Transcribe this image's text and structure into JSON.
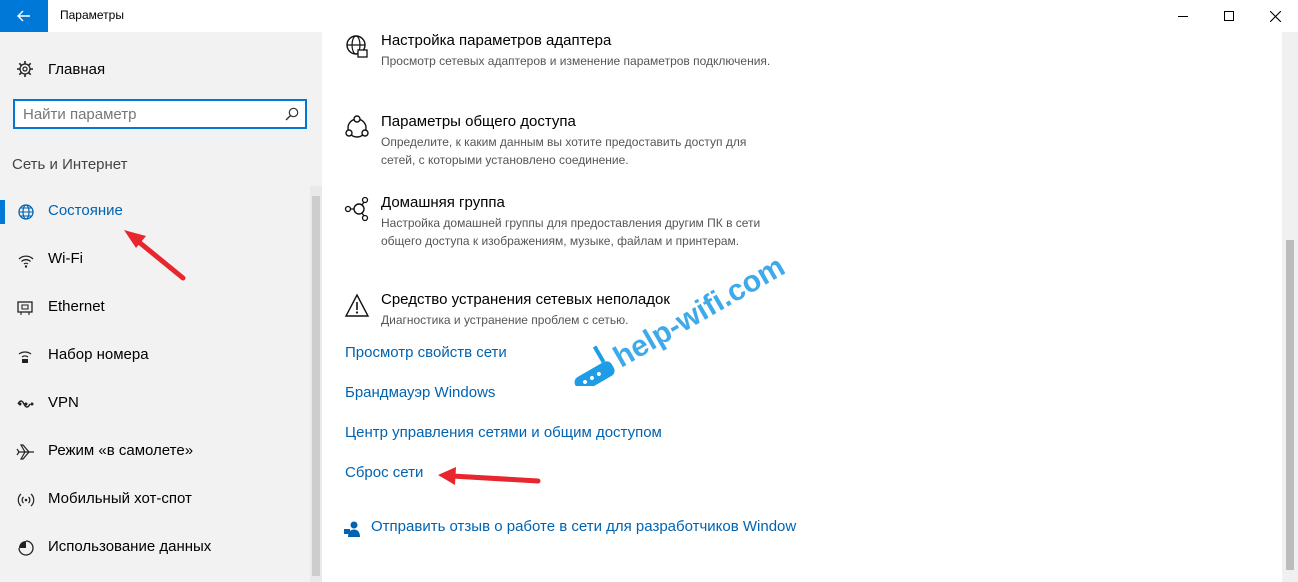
{
  "window": {
    "title": "Параметры"
  },
  "sidebar": {
    "home_label": "Главная",
    "search_placeholder": "Найти параметр",
    "section_title": "Сеть и Интернет",
    "items": [
      {
        "label": "Состояние",
        "icon": "globe-icon",
        "active": true
      },
      {
        "label": "Wi-Fi",
        "icon": "wifi-icon"
      },
      {
        "label": "Ethernet",
        "icon": "ethernet-icon"
      },
      {
        "label": "Набор номера",
        "icon": "dialup-icon"
      },
      {
        "label": "VPN",
        "icon": "vpn-icon"
      },
      {
        "label": "Режим «в самолете»",
        "icon": "airplane-icon"
      },
      {
        "label": "Мобильный хот-спот",
        "icon": "hotspot-icon"
      },
      {
        "label": "Использование данных",
        "icon": "data-usage-icon"
      }
    ]
  },
  "main": {
    "settings": [
      {
        "title": "Настройка параметров адаптера",
        "desc": "Просмотр сетевых адаптеров и изменение параметров подключения.",
        "icon": "adapter-icon"
      },
      {
        "title": "Параметры общего доступа",
        "desc": "Определите, к каким данным вы хотите предоставить доступ для сетей, с которыми установлено соединение.",
        "icon": "sharing-icon"
      },
      {
        "title": "Домашняя группа",
        "desc": "Настройка домашней группы для предоставления другим ПК в сети общего доступа к изображениям, музыке, файлам и принтерам.",
        "icon": "homegroup-icon"
      },
      {
        "title": "Средство устранения сетевых неполадок",
        "desc": "Диагностика и устранение проблем с сетью.",
        "icon": "warning-icon"
      }
    ],
    "links": [
      "Просмотр свойств сети",
      "Брандмауэр Windows",
      "Центр управления сетями и общим доступом",
      "Сброс сети"
    ],
    "feedback_label": "Отправить отзыв о работе в сети для разработчиков Window"
  },
  "watermark": "help-wifi.com",
  "colors": {
    "accent": "#0078d7",
    "link": "#0063b1",
    "annotation": "#e8262e"
  }
}
